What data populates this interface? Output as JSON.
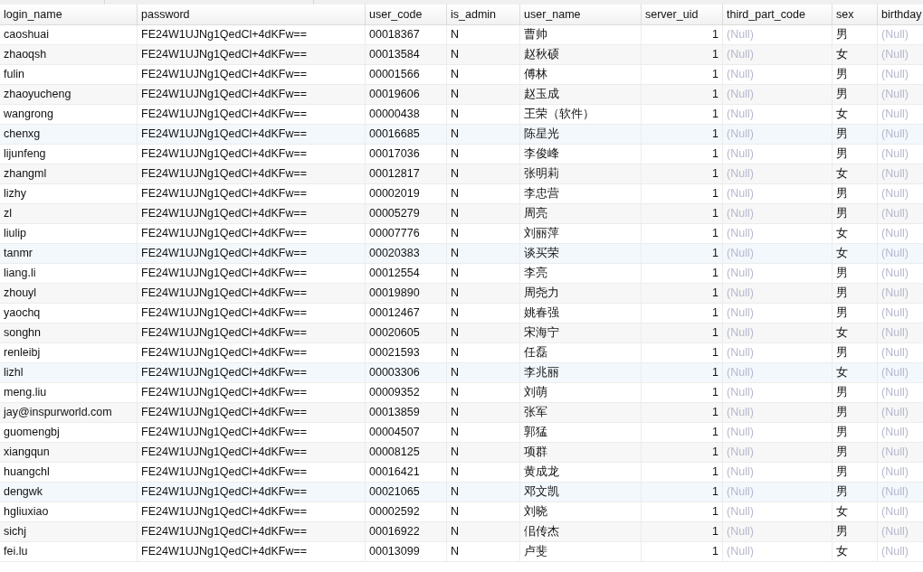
{
  "table": {
    "columns": [
      {
        "label": "login_name",
        "kind": "text"
      },
      {
        "label": "password",
        "kind": "text"
      },
      {
        "label": "user_code",
        "kind": "text"
      },
      {
        "label": "is_admin",
        "kind": "text"
      },
      {
        "label": "user_name",
        "kind": "text"
      },
      {
        "label": "server_uid",
        "kind": "number"
      },
      {
        "label": "third_part_code",
        "kind": "null"
      },
      {
        "label": "sex",
        "kind": "text"
      },
      {
        "label": "birthday",
        "kind": "null"
      }
    ],
    "rows": [
      {
        "cells": [
          "caoshuai",
          "FE24W1UJNg1QedCl+4dKFw==",
          "00018367",
          "N",
          "曹帅",
          "1",
          "(Null)",
          "男",
          "(Null)"
        ]
      },
      {
        "cells": [
          "zhaoqsh",
          "FE24W1UJNg1QedCl+4dKFw==",
          "00013584",
          "N",
          "赵秋硕",
          "1",
          "(Null)",
          "女",
          "(Null)"
        ]
      },
      {
        "cells": [
          "fulin",
          "FE24W1UJNg1QedCl+4dKFw==",
          "00001566",
          "N",
          "傅林",
          "1",
          "(Null)",
          "男",
          "(Null)"
        ]
      },
      {
        "cells": [
          "zhaoyucheng",
          "FE24W1UJNg1QedCl+4dKFw==",
          "00019606",
          "N",
          "赵玉成",
          "1",
          "(Null)",
          "男",
          "(Null)"
        ]
      },
      {
        "cells": [
          "wangrong",
          "FE24W1UJNg1QedCl+4dKFw==",
          "00000438",
          "N",
          "王荣（软件）",
          "1",
          "(Null)",
          "女",
          "(Null)"
        ]
      },
      {
        "cells": [
          "chenxg",
          "FE24W1UJNg1QedCl+4dKFw==",
          "00016685",
          "N",
          "陈星光",
          "1",
          "(Null)",
          "男",
          "(Null)"
        ]
      },
      {
        "cells": [
          "lijunfeng",
          "FE24W1UJNg1QedCl+4dKFw==",
          "00017036",
          "N",
          "李俊峰",
          "1",
          "(Null)",
          "男",
          "(Null)"
        ]
      },
      {
        "cells": [
          "zhangml",
          "FE24W1UJNg1QedCl+4dKFw==",
          "00012817",
          "N",
          "张明莉",
          "1",
          "(Null)",
          "女",
          "(Null)"
        ]
      },
      {
        "cells": [
          "lizhy",
          "FE24W1UJNg1QedCl+4dKFw==",
          "00002019",
          "N",
          "李忠营",
          "1",
          "(Null)",
          "男",
          "(Null)"
        ]
      },
      {
        "cells": [
          "zl",
          "FE24W1UJNg1QedCl+4dKFw==",
          "00005279",
          "N",
          "周亮",
          "1",
          "(Null)",
          "男",
          "(Null)"
        ]
      },
      {
        "cells": [
          "liulip",
          "FE24W1UJNg1QedCl+4dKFw==",
          "00007776",
          "N",
          "刘丽萍",
          "1",
          "(Null)",
          "女",
          "(Null)"
        ]
      },
      {
        "cells": [
          "tanmr",
          "FE24W1UJNg1QedCl+4dKFw==",
          "00020383",
          "N",
          "谈买荣",
          "1",
          "(Null)",
          "女",
          "(Null)"
        ]
      },
      {
        "cells": [
          "liang.li",
          "FE24W1UJNg1QedCl+4dKFw==",
          "00012554",
          "N",
          "李亮",
          "1",
          "(Null)",
          "男",
          "(Null)"
        ]
      },
      {
        "cells": [
          "zhouyl",
          "FE24W1UJNg1QedCl+4dKFw==",
          "00019890",
          "N",
          "周尧力",
          "1",
          "(Null)",
          "男",
          "(Null)"
        ]
      },
      {
        "cells": [
          "yaochq",
          "FE24W1UJNg1QedCl+4dKFw==",
          "00012467",
          "N",
          "姚春强",
          "1",
          "(Null)",
          "男",
          "(Null)"
        ]
      },
      {
        "cells": [
          "songhn",
          "FE24W1UJNg1QedCl+4dKFw==",
          "00020605",
          "N",
          "宋海宁",
          "1",
          "(Null)",
          "女",
          "(Null)"
        ]
      },
      {
        "cells": [
          "renleibj",
          "FE24W1UJNg1QedCl+4dKFw==",
          "00021593",
          "N",
          "任磊",
          "1",
          "(Null)",
          "男",
          "(Null)"
        ]
      },
      {
        "cells": [
          "lizhl",
          "FE24W1UJNg1QedCl+4dKFw==",
          "00003306",
          "N",
          "李兆丽",
          "1",
          "(Null)",
          "女",
          "(Null)"
        ]
      },
      {
        "cells": [
          "meng.liu",
          "FE24W1UJNg1QedCl+4dKFw==",
          "00009352",
          "N",
          "刘萌",
          "1",
          "(Null)",
          "男",
          "(Null)"
        ]
      },
      {
        "cells": [
          "jay@inspurworld.com",
          "FE24W1UJNg1QedCl+4dKFw==",
          "00013859",
          "N",
          "张军",
          "1",
          "(Null)",
          "男",
          "(Null)"
        ]
      },
      {
        "cells": [
          "guomengbj",
          "FE24W1UJNg1QedCl+4dKFw==",
          "00004507",
          "N",
          "郭猛",
          "1",
          "(Null)",
          "男",
          "(Null)"
        ]
      },
      {
        "cells": [
          "xiangqun",
          "FE24W1UJNg1QedCl+4dKFw==",
          "00008125",
          "N",
          "项群",
          "1",
          "(Null)",
          "男",
          "(Null)"
        ]
      },
      {
        "cells": [
          "huangchl",
          "FE24W1UJNg1QedCl+4dKFw==",
          "00016421",
          "N",
          "黄成龙",
          "1",
          "(Null)",
          "男",
          "(Null)"
        ]
      },
      {
        "cells": [
          "dengwk",
          "FE24W1UJNg1QedCl+4dKFw==",
          "00021065",
          "N",
          "邓文凯",
          "1",
          "(Null)",
          "男",
          "(Null)"
        ]
      },
      {
        "cells": [
          "hgliuxiao",
          "FE24W1UJNg1QedCl+4dKFw==",
          "00002592",
          "N",
          "刘晓",
          "1",
          "(Null)",
          "女",
          "(Null)"
        ]
      },
      {
        "cells": [
          "sichj",
          "FE24W1UJNg1QedCl+4dKFw==",
          "00016922",
          "N",
          "佀传杰",
          "1",
          "(Null)",
          "男",
          "(Null)"
        ]
      },
      {
        "cells": [
          "fei.lu",
          "FE24W1UJNg1QedCl+4dKFw==",
          "00013099",
          "N",
          "卢斐",
          "1",
          "(Null)",
          "女",
          "(Null)"
        ]
      }
    ]
  }
}
